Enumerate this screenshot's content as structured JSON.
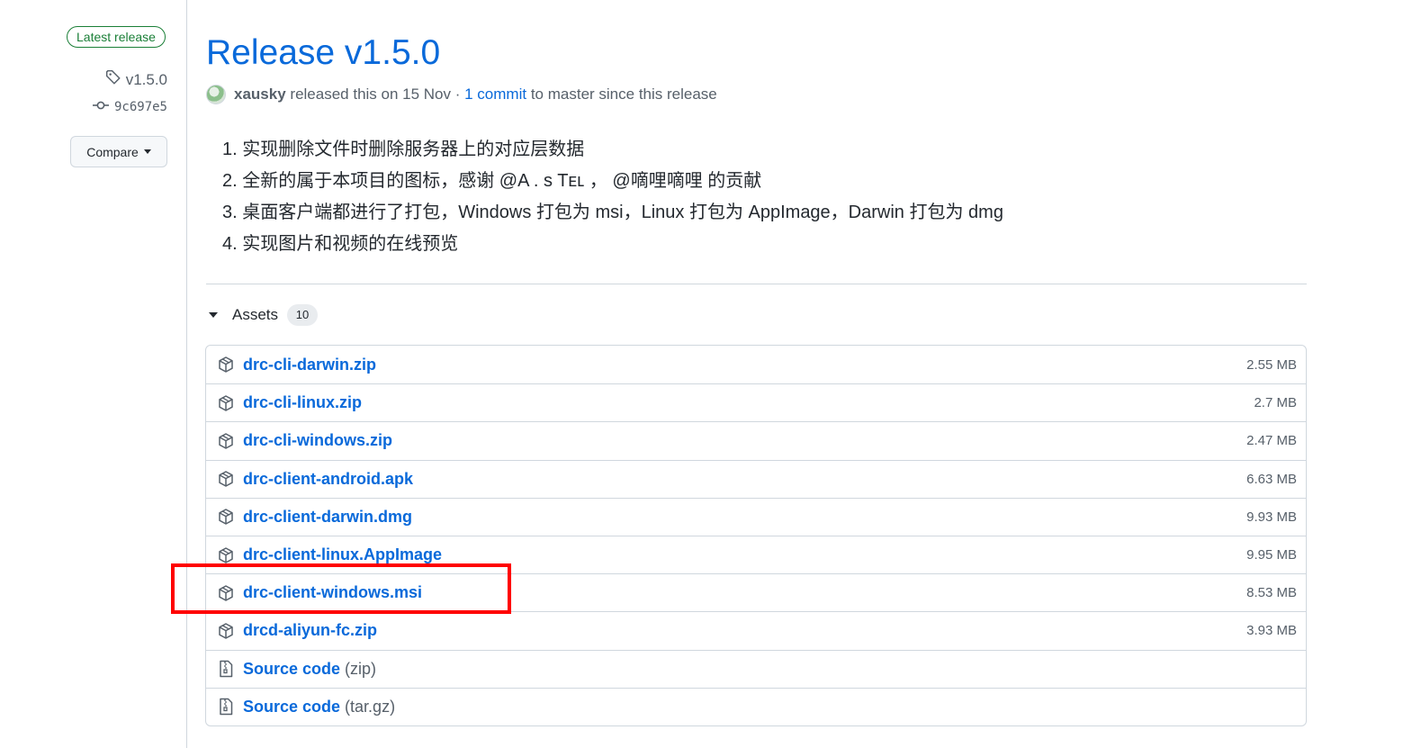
{
  "sidebar": {
    "latest_badge": "Latest release",
    "tag": "v1.5.0",
    "commit": "9c697e5",
    "compare_label": "Compare"
  },
  "release": {
    "title": "Release v1.5.0",
    "author": "xausky",
    "released_text": "released this on 15 Nov",
    "separator": " · ",
    "commits_link": "1 commit",
    "commits_suffix": "to master since this release",
    "notes": [
      "1. 实现删除文件时删除服务器上的对应层数据",
      "2. 全新的属于本项目的图标，感谢 @A . s Tᴇʟ ， @嘀哩嘀哩 的贡献",
      "3. 桌面客户端都进行了打包，Windows 打包为 msi，Linux 打包为 AppImage，Darwin 打包为 dmg",
      "4. 实现图片和视频的在线预览"
    ]
  },
  "assets": {
    "heading": "Assets",
    "count": "10",
    "files": [
      {
        "name": "drc-cli-darwin.zip",
        "size": "2.55 MB"
      },
      {
        "name": "drc-cli-linux.zip",
        "size": "2.7 MB"
      },
      {
        "name": "drc-cli-windows.zip",
        "size": "2.47 MB"
      },
      {
        "name": "drc-client-android.apk",
        "size": "6.63 MB"
      },
      {
        "name": "drc-client-darwin.dmg",
        "size": "9.93 MB"
      },
      {
        "name": "drc-client-linux.AppImage",
        "size": "9.95 MB"
      },
      {
        "name": "drc-client-windows.msi",
        "size": "8.53 MB"
      },
      {
        "name": "drcd-aliyun-fc.zip",
        "size": "3.93 MB"
      }
    ],
    "source": [
      {
        "name": "Source code",
        "suffix": "(zip)"
      },
      {
        "name": "Source code",
        "suffix": "(tar.gz)"
      }
    ]
  },
  "colors": {
    "link": "#0969da",
    "badge_green": "#1a7f37",
    "highlight": "#ff0000"
  }
}
